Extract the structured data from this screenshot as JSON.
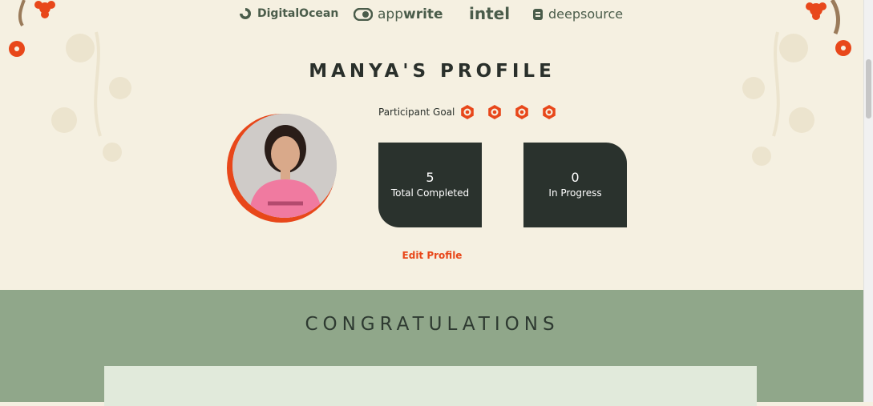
{
  "sponsors": {
    "digitalocean": "DigitalOcean",
    "appwrite_light": "app",
    "appwrite_bold": "write",
    "intel": "intel",
    "deepsource": "deepsource"
  },
  "profile": {
    "title": "MANYA'S PROFILE",
    "goal_label": "Participant Goal",
    "goal_icons": [
      "badge-icon",
      "badge-icon",
      "badge-icon",
      "badge-icon"
    ],
    "edit_label": "Edit Profile"
  },
  "stats": {
    "completed_value": "5",
    "completed_label": "Total Completed",
    "progress_value": "0",
    "progress_label": "In Progress"
  },
  "congrats": {
    "title": "CONGRATULATIONS"
  },
  "colors": {
    "cream": "#f5f0e1",
    "accent": "#e8471a",
    "dark_card": "#2a322d",
    "sage": "#90a78a",
    "panel": "#e1eadb"
  }
}
